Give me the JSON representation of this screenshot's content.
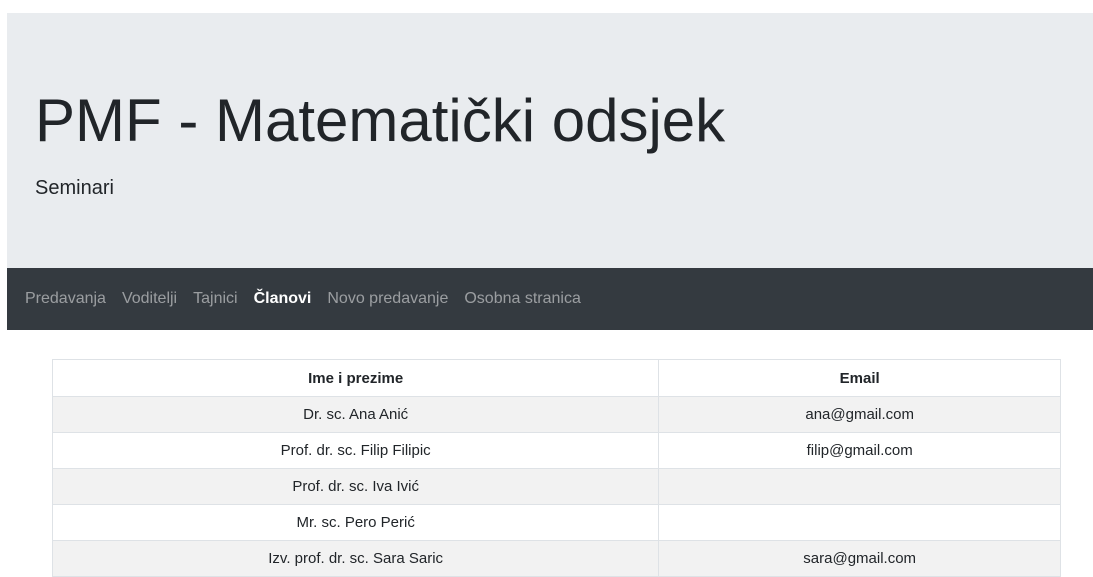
{
  "header": {
    "title": "PMF - Matematički odsjek",
    "subtitle": "Seminari"
  },
  "nav": {
    "items": [
      {
        "label": "Predavanja",
        "active": false
      },
      {
        "label": "Voditelji",
        "active": false
      },
      {
        "label": "Tajnici",
        "active": false
      },
      {
        "label": "Članovi",
        "active": true
      },
      {
        "label": "Novo predavanje",
        "active": false
      },
      {
        "label": "Osobna stranica",
        "active": false
      }
    ]
  },
  "table": {
    "columns": [
      "Ime i prezime",
      "Email"
    ],
    "rows": [
      [
        "Dr. sc. Ana Anić",
        "ana@gmail.com"
      ],
      [
        "Prof. dr. sc. Filip Filipic",
        "filip@gmail.com"
      ],
      [
        "Prof. dr. sc. Iva Ivić",
        ""
      ],
      [
        "Mr. sc. Pero Perić",
        ""
      ],
      [
        "Izv. prof. dr. sc. Sara Saric",
        "sara@gmail.com"
      ]
    ]
  },
  "colors": {
    "jumbotron_bg": "#e9ecef",
    "navbar_bg": "#343a40",
    "striped_row": "#f2f2f2"
  }
}
